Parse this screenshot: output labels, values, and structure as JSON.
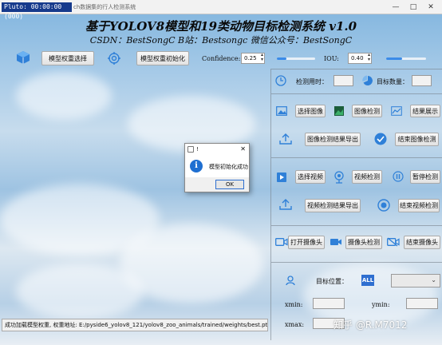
{
  "window": {
    "badge": "Pluto: 00:00:00 (000)",
    "title": "ch数据集的行人检测系统",
    "min": "—",
    "max": "□",
    "close": "✕"
  },
  "header": {
    "title": "基于YOLOV8模型和19类动物目标检测系统 v1.0",
    "subtitle": "CSDN：BestSongC   B站：Bestsongc   微信公众号：BestSongC"
  },
  "top": {
    "model_select": "模型权重选择",
    "model_init": "模型权重初始化",
    "confidence_label": "Confidence:",
    "confidence_value": "0.25",
    "iou_label": "IOU:",
    "iou_value": "0.40",
    "confidence_level": 0.25,
    "iou_level": 0.4
  },
  "panel": {
    "detect_time": "检测用时：",
    "target_count": "目标数量：",
    "select_image": "选择图像",
    "image_detect": "图像检测",
    "result_show": "结果展示",
    "image_export": "图像检测结果导出",
    "end_image": "结束图像检测",
    "select_video": "选择视频",
    "video_detect": "视频检测",
    "pause_detect": "暂停检测",
    "video_export": "视频检测结果导出",
    "end_video": "结束视频检测",
    "open_camera": "打开摄像头",
    "camera_detect": "摄像头检测",
    "end_camera": "结束摄像头",
    "target_position": "目标位置：",
    "all_badge": "ALL",
    "xmin": "xmin:",
    "ymin": "ymin:",
    "xmax": "xmax:"
  },
  "dialog": {
    "title": "!",
    "message": "模型初始化成功",
    "ok": "OK",
    "close": "✕"
  },
  "status": {
    "text": "成功加载模型权重, 权重地址: E:/pyside6_yolov8_121/yolov8_zoo_animals/trained/weights/best.pt"
  },
  "watermark": {
    "text": "知乎 @R.M7012"
  },
  "colors": {
    "accent": "#3b8be8",
    "badge": "#163a8c"
  }
}
